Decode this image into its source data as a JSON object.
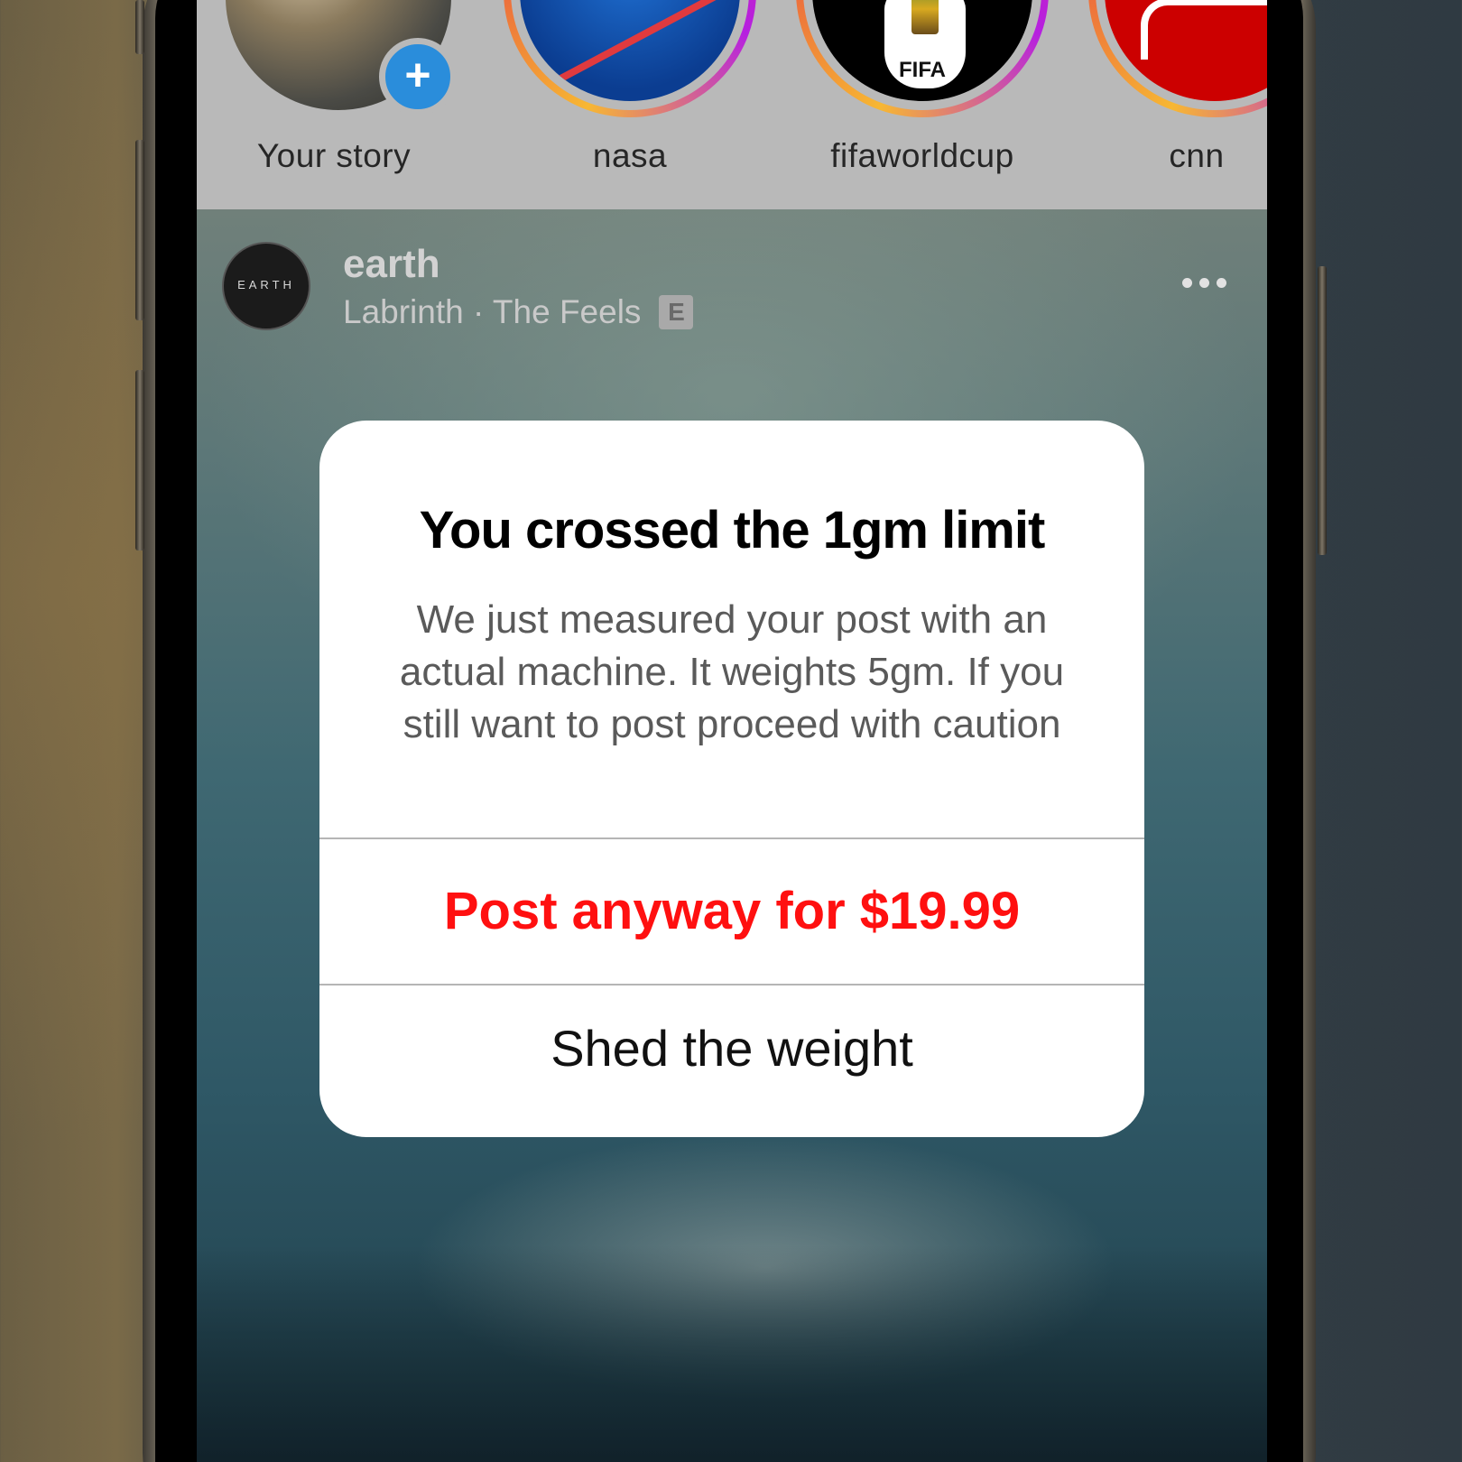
{
  "stories": [
    {
      "label": "Your story",
      "avatar_icon": "profile-photo",
      "has_add": true
    },
    {
      "label": "nasa",
      "avatar_icon": "nasa-logo"
    },
    {
      "label": "fifaworldcup",
      "avatar_icon": "fifa-logo",
      "logo_text": "FIFA"
    },
    {
      "label": "cnn",
      "avatar_icon": "cnn-logo"
    }
  ],
  "post": {
    "avatar_text": "EARTH",
    "username": "earth",
    "audio": "Labrinth · The Feels",
    "explicit_badge": "E",
    "more_icon": "more-dots-icon"
  },
  "dialog": {
    "title": "You crossed the 1gm limit",
    "message": "We just measured your post with an actual machine. It weights 5gm. If you still want to post proceed with caution",
    "primary_button": "Post anyway for $19.99",
    "secondary_button": "Shed the weight"
  },
  "colors": {
    "accent_destructive": "#ff1010",
    "add_badge": "#2a8ddb",
    "dialog_background": "#ffffff"
  }
}
